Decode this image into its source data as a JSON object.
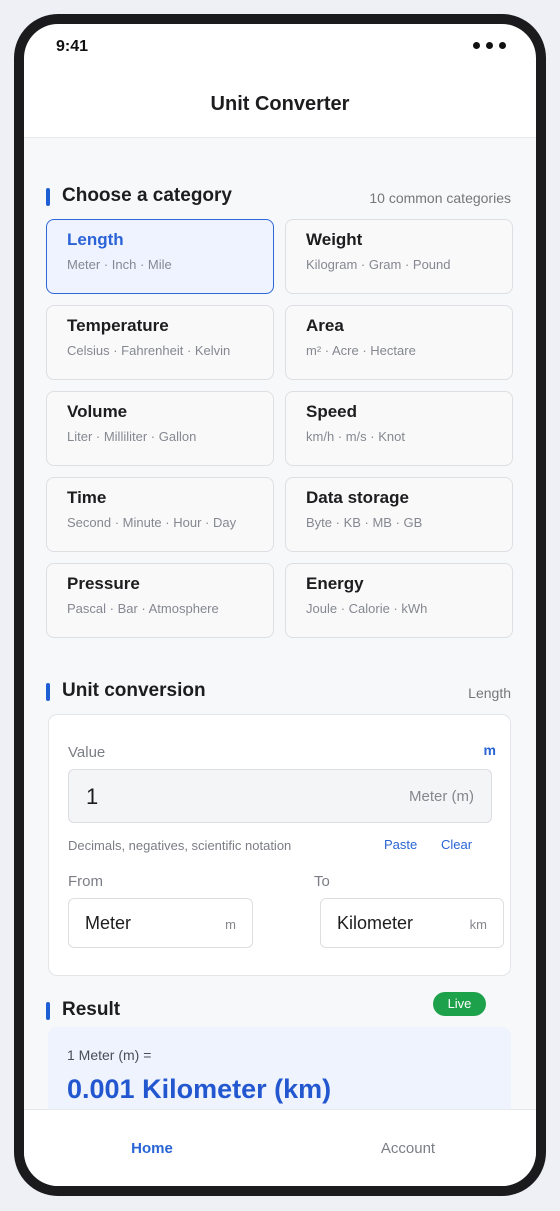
{
  "status_bar": {
    "time": "9:41"
  },
  "header": {
    "title": "Unit Converter"
  },
  "category_section": {
    "title": "Choose a category",
    "meta": "10 common categories",
    "selected": "Length",
    "categories": [
      {
        "name": "Length",
        "units": "Meter · Inch · Mile"
      },
      {
        "name": "Weight",
        "units": "Kilogram · Gram · Pound"
      },
      {
        "name": "Temperature",
        "units": "Celsius · Fahrenheit · Kelvin"
      },
      {
        "name": "Area",
        "units": "m² · Acre · Hectare"
      },
      {
        "name": "Volume",
        "units": "Liter · Milliliter · Gallon"
      },
      {
        "name": "Speed",
        "units": "km/h · m/s · Knot"
      },
      {
        "name": "Time",
        "units": "Second · Minute · Hour · Day"
      },
      {
        "name": "Data storage",
        "units": "Byte · KB · MB · GB"
      },
      {
        "name": "Pressure",
        "units": "Pascal · Bar · Atmosphere"
      },
      {
        "name": "Energy",
        "units": "Joule · Calorie · kWh"
      }
    ]
  },
  "conversion_section": {
    "title": "Unit conversion",
    "meta": "Length",
    "value_label": "Value",
    "unit_symbol": "m",
    "value": "1",
    "value_unit": "Meter (m)",
    "hint": "Decimals, negatives, scientific notation",
    "paste_label": "Paste",
    "clear_label": "Clear",
    "from_label": "From",
    "to_label": "To",
    "from_unit": {
      "name": "Meter",
      "symbol": "m"
    },
    "to_unit": {
      "name": "Kilometer",
      "symbol": "km"
    }
  },
  "result_section": {
    "title": "Result",
    "badge": "Live",
    "prefix": "1 Meter (m) =",
    "value": "0.001",
    "unit": "Kilometer (km)"
  },
  "tab_bar": {
    "home_label": "Home",
    "account_label": "Account"
  },
  "colors": {
    "accent": "#2864d4",
    "live_badge": "#1ea14b",
    "selected_card_bg": "#eef3ff"
  }
}
